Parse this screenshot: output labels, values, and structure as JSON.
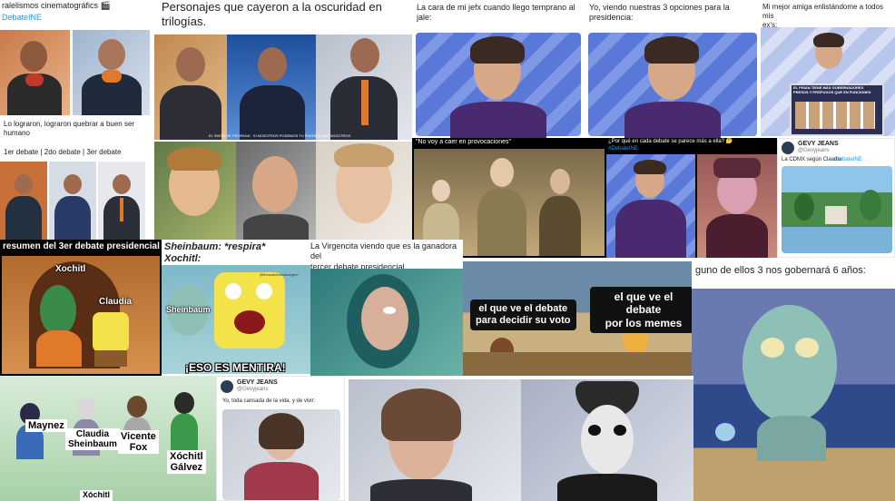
{
  "tiles": {
    "t1": {
      "caption_top": "ralelismos cinematográfics 🎬",
      "hashtag": "DebateINE",
      "caption_mid": "Lo lograron,  lograron quebrar a buen ser\nhumano",
      "caption_low": "1er debate | 2do debate | 3er debate"
    },
    "t2": {
      "caption": "Personajes que cayeron a la oscuridad en\ntrilogías.",
      "subtitle": "EL SHOW DE PROPAGA · SI NOSOTROS PODEMOS TU PUEDES CON NOSOTROS"
    },
    "t3": {
      "caption": "La cara de mi jefx cuando llego temprano al\njale:"
    },
    "t4": {
      "caption": "Yo, viendo nuestras 3 opciones para la\npresidencia:"
    },
    "t5": {
      "caption": "Mi mejor amiga enlistándome a todos mis\nex's:",
      "board_text": "EL PRIAN TIENE MÁS GOBERNADORES PRESOS Y PRÓFUGOS QUE EN FUNCIONES"
    },
    "t6": {
      "caption": "\"No voy a caer en provocaciones\""
    },
    "t7": {
      "caption": "¿Por qué en cada debate se parece más a ella? 🤔",
      "hashtag": "#DebateINE"
    },
    "t8": {
      "name": "GEVY JEANS",
      "handle": "@Gevyjeans",
      "caption": "La CDMX según Claudia",
      "hashtag": "#DebateINE"
    },
    "t9": {
      "header": "resumen del 3er debate presidencial",
      "label_a": "Xochitl",
      "label_b": "Claudia"
    },
    "t10": {
      "header_line1": "Sheinbaum: *respira*",
      "header_line2": "Xochitl:",
      "label": "Sheinbaum",
      "bottom": "¡ESO ES MENTIRA!",
      "watermark": "@thesadcheeseburgers"
    },
    "t11": {
      "caption": "La Virgencita viendo que es la ganadora del\ntercer debate presidencial"
    },
    "t12": {
      "box_a": "el que ve el debate\npara decidir su voto",
      "box_b": "el que ve el debate\npor los memes"
    },
    "t13": {
      "caption": "guno de ellos 3 nos gobernará 6 años:"
    },
    "t14": {
      "label_1": "Maynez",
      "label_2": "Claudia\nSheinbaum",
      "label_3": "Vicente\nFox",
      "label_4": "Xóchitl\nGálvez",
      "label_5": "Xóchitl"
    },
    "t15": {
      "name": "GEVY JEANS",
      "handle": "@Gevyjeans",
      "caption": "Yo, toda cansada de la vida, y de vivir:"
    }
  },
  "colors": {
    "slide_blue": "#5a78d8",
    "twitter_blue": "#1d9bf0",
    "spongebob_yellow": "#f4e24a",
    "squidward": "#8fc0b8",
    "suit_purple": "#4a2a6e"
  }
}
